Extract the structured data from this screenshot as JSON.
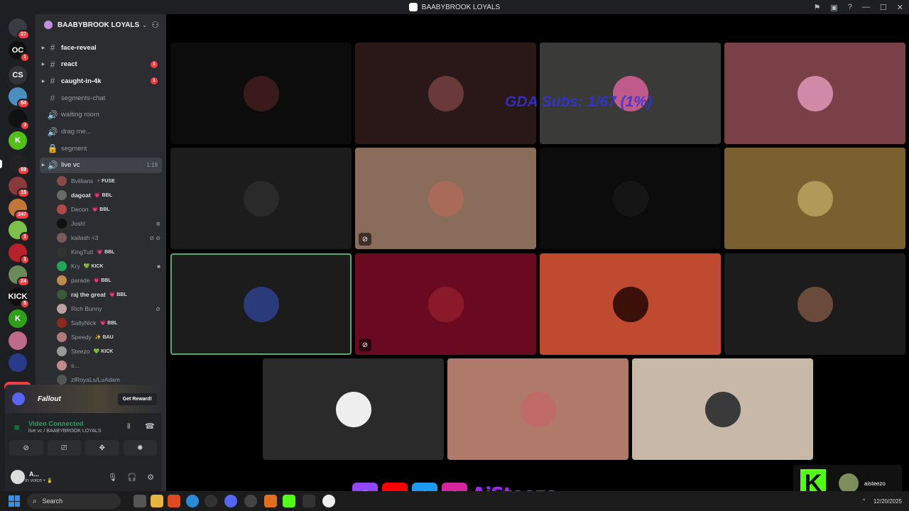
{
  "window": {
    "title": "BAABYBROOK LOYALS"
  },
  "rail": {
    "servers": [
      {
        "name": "discord-home",
        "label": "",
        "count": "27",
        "color": "#3a3c43"
      },
      {
        "name": "server-oc",
        "label": "OC",
        "count": "1",
        "color": "#111111"
      },
      {
        "name": "server-cs",
        "label": "CS",
        "count": "",
        "color": "#313338"
      },
      {
        "name": "server-4",
        "label": "",
        "count": "54",
        "color": "#4a8fc0"
      },
      {
        "name": "server-5",
        "label": "",
        "count": "3",
        "color": "#111111"
      },
      {
        "name": "server-kick",
        "label": "K",
        "count": "",
        "color": "#53c018"
      },
      {
        "name": "server-active",
        "label": "",
        "count": "69",
        "color": "#222222"
      },
      {
        "name": "server-8",
        "label": "",
        "count": "15",
        "color": "#8a3a3a"
      },
      {
        "name": "server-9",
        "label": "",
        "count": "247",
        "color": "#c0783a"
      },
      {
        "name": "server-10",
        "label": "",
        "count": "1",
        "color": "#7ac04a"
      },
      {
        "name": "server-11",
        "label": "",
        "count": "1",
        "color": "#b8202a"
      },
      {
        "name": "server-12",
        "label": "",
        "count": "24",
        "color": "#6a8a5a"
      },
      {
        "name": "server-kick-2",
        "label": "KICK",
        "count": "5",
        "color": "#0f0f0f"
      },
      {
        "name": "server-kick-3",
        "label": "K",
        "count": "",
        "color": "#2fa018"
      },
      {
        "name": "server-15",
        "label": "",
        "count": "",
        "color": "#c06a8a"
      },
      {
        "name": "server-16",
        "label": "",
        "count": "",
        "color": "#2a3a8a"
      }
    ],
    "new_label": "NEW"
  },
  "sidebar": {
    "guild": "BAABYBROOK LOYALS",
    "channels": [
      {
        "label": "face-reveal",
        "icon": "#",
        "state": "unread",
        "badge": "",
        "time": ""
      },
      {
        "label": "react",
        "icon": "#",
        "state": "unread",
        "badge": "1",
        "time": ""
      },
      {
        "label": "caught-in-4k",
        "icon": "#",
        "state": "unread",
        "badge": "1",
        "time": ""
      },
      {
        "label": "segments-chat",
        "icon": "#",
        "state": "",
        "badge": "",
        "time": ""
      },
      {
        "label": "waiting room",
        "icon": "🔊",
        "state": "",
        "badge": "",
        "time": ""
      },
      {
        "label": "drag me...",
        "icon": "🔊",
        "state": "",
        "badge": "",
        "time": ""
      },
      {
        "label": "segment",
        "icon": "🔒",
        "state": "",
        "badge": "",
        "time": ""
      },
      {
        "label": "live vc",
        "icon": "🔊",
        "state": "active",
        "badge": "",
        "time": "1:19"
      }
    ],
    "voice_users": [
      {
        "name": "Bvillians",
        "tag": "FUSE",
        "tag_icon": "⚡",
        "right": "",
        "bold": false,
        "color": "#8a4a4a"
      },
      {
        "name": "dagoat",
        "tag": "BBL",
        "tag_icon": "💗",
        "right": "",
        "bold": true,
        "color": "#6a6a6a"
      },
      {
        "name": "Decon",
        "tag": "BBL",
        "tag_icon": "💗",
        "right": "",
        "bold": false,
        "color": "#b04a4a"
      },
      {
        "name": "Josh!",
        "tag": "",
        "tag_icon": "",
        "right": "⊗",
        "bold": false,
        "color": "#111111"
      },
      {
        "name": "kailash <3",
        "tag": "",
        "tag_icon": "",
        "right": "⊘ ⊘",
        "bold": false,
        "color": "#7a5a5a"
      },
      {
        "name": "KingTutt",
        "tag": "BBL",
        "tag_icon": "💗",
        "right": "",
        "bold": false,
        "color": "#333333"
      },
      {
        "name": "Kry",
        "tag": "KICK",
        "tag_icon": "💚",
        "right": "■",
        "bold": false,
        "color": "#23a55a"
      },
      {
        "name": "parade",
        "tag": "BBL",
        "tag_icon": "💗",
        "right": "",
        "bold": false,
        "color": "#c08a4a"
      },
      {
        "name": "raj the great",
        "tag": "BBL",
        "tag_icon": "💗",
        "right": "",
        "bold": true,
        "color": "#3a5a3a"
      },
      {
        "name": "Rich Bunny",
        "tag": "",
        "tag_icon": "",
        "right": "⊘",
        "bold": false,
        "color": "#c0a0a0"
      },
      {
        "name": "SaltyNick",
        "tag": "BBL",
        "tag_icon": "💗",
        "right": "",
        "bold": false,
        "color": "#8a2a1a"
      },
      {
        "name": "Speedy",
        "tag": "BAU",
        "tag_icon": "✨",
        "right": "",
        "bold": false,
        "color": "#b07a7a"
      },
      {
        "name": "Steezo",
        "tag": "KICK",
        "tag_icon": "💚",
        "right": "",
        "bold": false,
        "color": "#9a9a9a"
      },
      {
        "name": "s...",
        "tag": "",
        "tag_icon": "",
        "right": "",
        "bold": false,
        "color": "#c08a8a"
      },
      {
        "name": "zlRoyaLs/LuAdam",
        "tag": "",
        "tag_icon": "",
        "right": "",
        "bold": false,
        "color": "#555555"
      }
    ],
    "promo": {
      "title": "Fallout",
      "button": "Get Reward!"
    },
    "voice": {
      "status": "Video Connected",
      "location": "live vc / BAABYBROOK LOYALS"
    },
    "user": {
      "name": "A...",
      "status": "In voice • 🍍"
    }
  },
  "stage": {
    "overlay_text": "GDA Subs: 1/67 (1%)",
    "tiles": [
      {
        "bg": "#0c0c0c",
        "av": "#3a1a1a",
        "icon": "",
        "speaking": false
      },
      {
        "bg": "#2a1818",
        "av": "#6a3a3a",
        "icon": "",
        "speaking": false
      },
      {
        "bg": "#3a3a38",
        "av": "#c05a8a",
        "icon": "",
        "speaking": false
      },
      {
        "bg": "#7a4048",
        "av": "#d08aa8",
        "icon": "",
        "speaking": false
      },
      {
        "bg": "#1c1c1c",
        "av": "#2a2a2a",
        "icon": "",
        "speaking": false
      },
      {
        "bg": "#8a6c5a",
        "av": "#aa6a5a",
        "icon": "⊘",
        "speaking": false
      },
      {
        "bg": "#0c0c0c",
        "av": "#151515",
        "icon": "",
        "speaking": false
      },
      {
        "bg": "#7a6030",
        "av": "#b09a5a",
        "icon": "",
        "speaking": false
      },
      {
        "bg": "#1c1c1c",
        "av": "#2a3a7a",
        "icon": "",
        "speaking": true
      },
      {
        "bg": "#6a0a20",
        "av": "#8a1a2a",
        "icon": "⊘",
        "speaking": false
      },
      {
        "bg": "#c04a30",
        "av": "#3a1008",
        "icon": "",
        "speaking": false
      },
      {
        "bg": "#1c1c1c",
        "av": "#6a4a3a",
        "icon": "",
        "speaking": false
      },
      {
        "bg": "#2a2a2a",
        "av": "#eeeeee",
        "icon": "",
        "speaking": false
      },
      {
        "bg": "#b07a6a",
        "av": "#c06a6a",
        "icon": "",
        "speaking": false
      },
      {
        "bg": "#c8b8a8",
        "av": "#3a3a3a",
        "icon": "",
        "speaking": false
      }
    ],
    "kick_overlay": {
      "logo": "K",
      "name": "aisteezo"
    }
  },
  "socials": {
    "handle": "AiSteezo"
  },
  "taskbar": {
    "search_placeholder": "Search",
    "date": "12/20/2025"
  }
}
